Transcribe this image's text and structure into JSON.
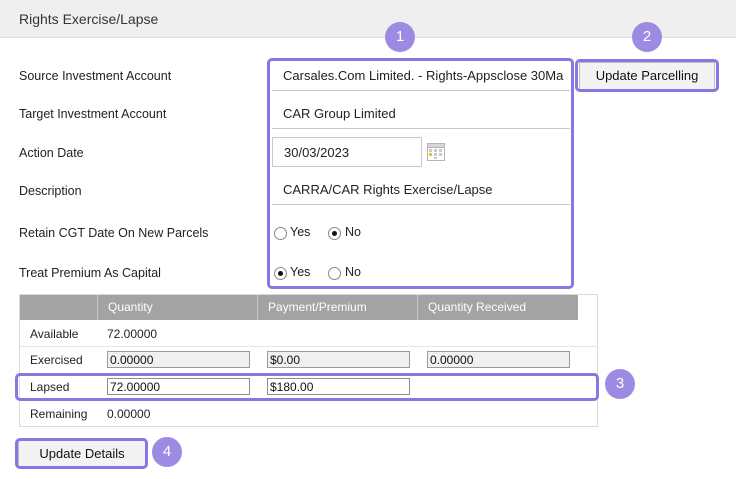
{
  "header": {
    "title": "Rights Exercise/Lapse"
  },
  "form": {
    "source_label": "Source Investment Account",
    "source_value": "Carsales.Com Limited. - Rights-Appsclose 30Ma",
    "target_label": "Target Investment Account",
    "target_value": "CAR Group Limited",
    "date_label": "Action Date",
    "date_value": "30/03/2023",
    "description_label": "Description",
    "description_value": "CARRA/CAR Rights Exercise/Lapse",
    "retain_label": "Retain CGT Date On New Parcels",
    "retain_yes": "Yes",
    "retain_no": "No",
    "retain_selected": "No",
    "premium_label": "Treat Premium As Capital",
    "premium_yes": "Yes",
    "premium_no": "No",
    "premium_selected": "Yes"
  },
  "buttons": {
    "update_parcelling": "Update Parcelling",
    "update_details": "Update Details"
  },
  "table": {
    "headers": [
      "",
      "Quantity",
      "Payment/Premium",
      "Quantity Received"
    ],
    "available": {
      "label": "Available",
      "quantity": "72.00000"
    },
    "exercised": {
      "label": "Exercised",
      "quantity": "0.00000",
      "payment": "$0.00",
      "received": "0.00000"
    },
    "lapsed": {
      "label": "Lapsed",
      "quantity": "72.00000",
      "payment": "$180.00"
    },
    "remaining": {
      "label": "Remaining",
      "quantity": "0.00000"
    }
  },
  "annotations": {
    "badge1": "1",
    "badge2": "2",
    "badge3": "3",
    "badge4": "4",
    "highlight_color": "#8a76e0",
    "badge_color": "#9d8be3"
  }
}
